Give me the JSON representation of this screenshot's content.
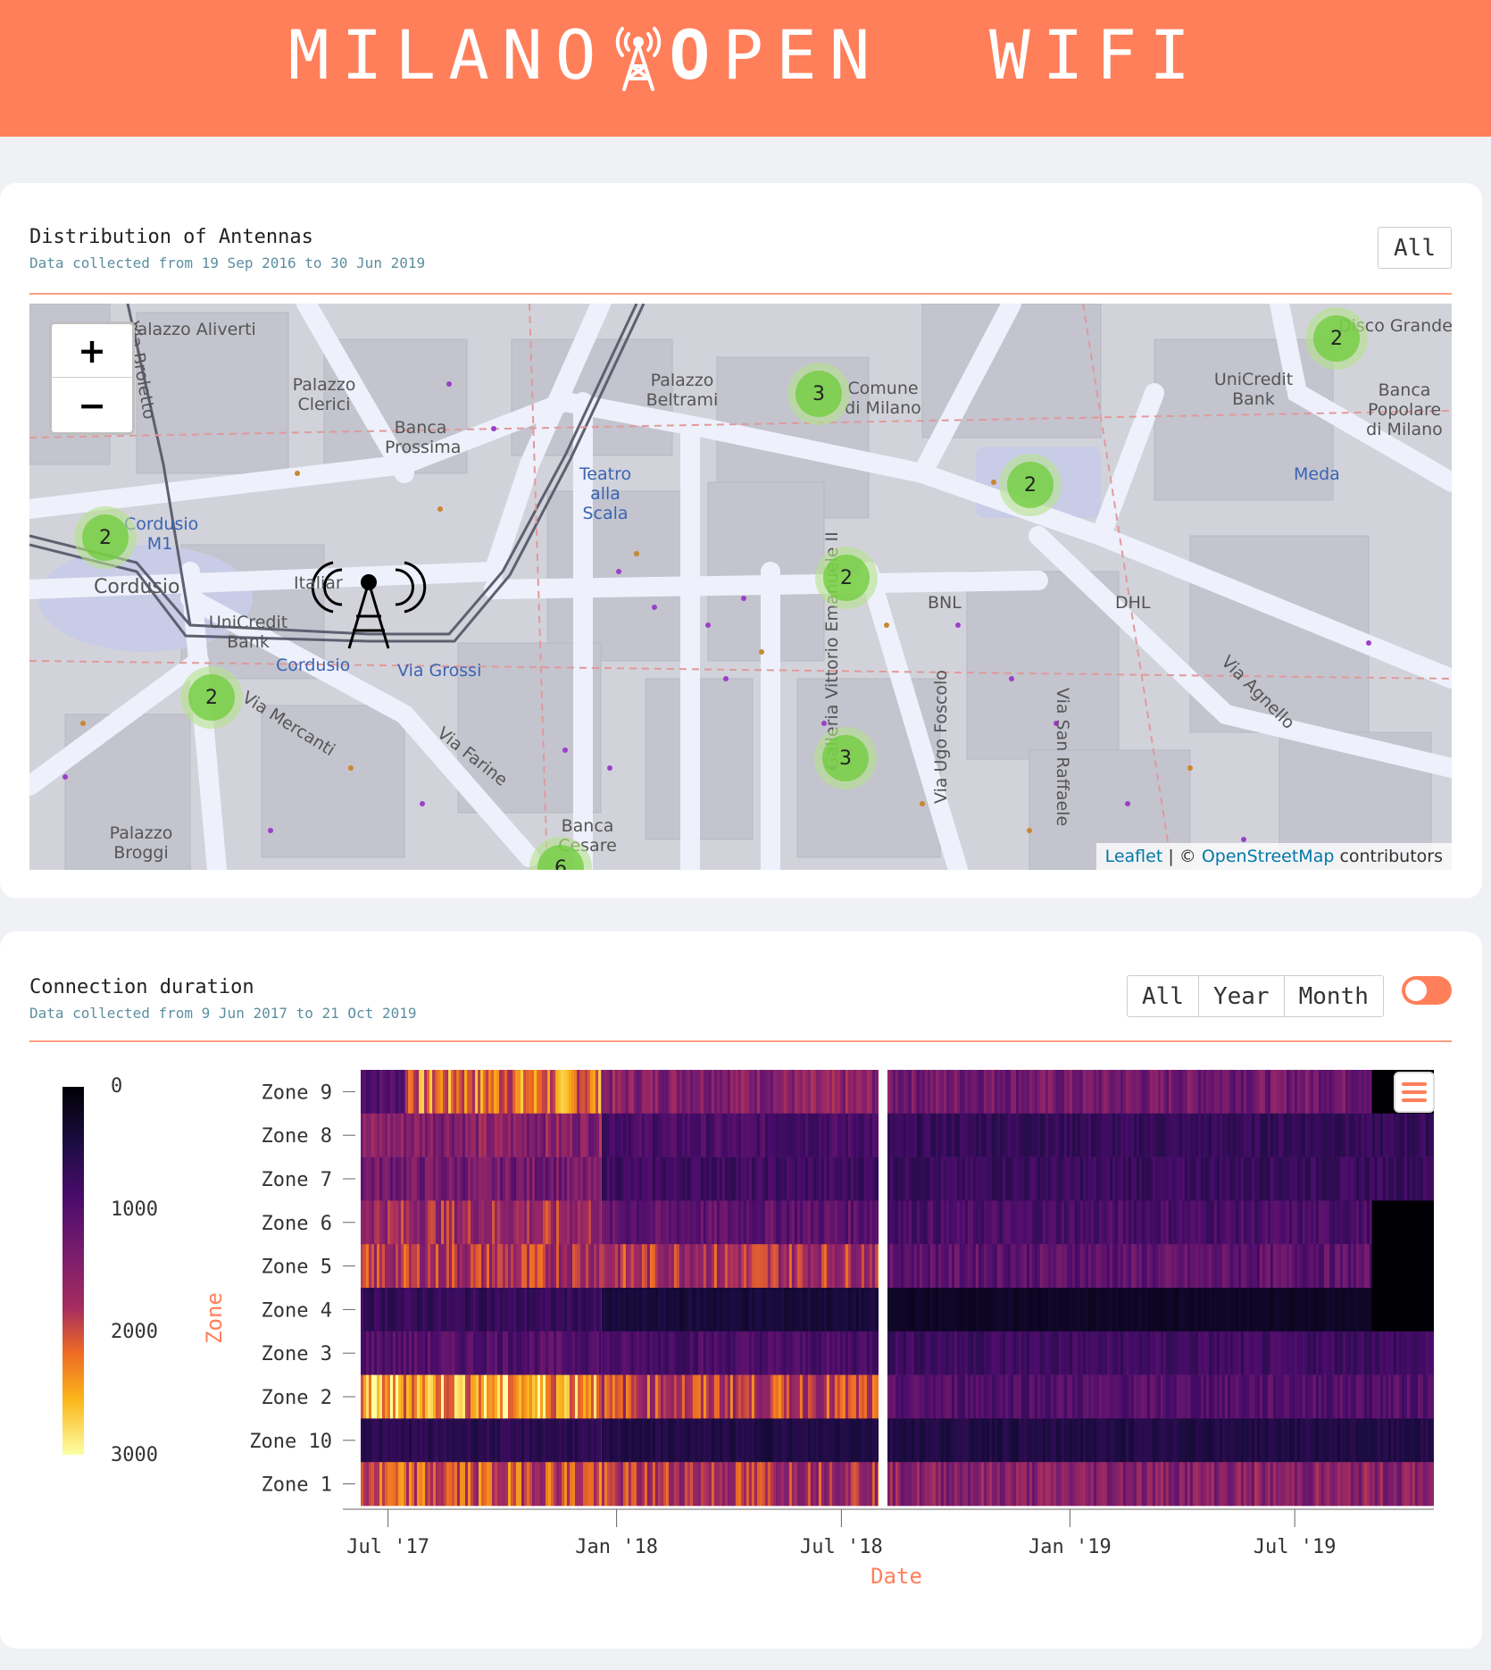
{
  "header": {
    "logo_part1": "MILANO",
    "logo_part2_bold": "O",
    "logo_part2": "PEN",
    "logo_part3": "WIFI",
    "tower_icon": "antenna-tower-icon",
    "bg_color": "#ff7f5a"
  },
  "map_card": {
    "title": "Distribution of Antennas",
    "subtitle": "Data collected from 19 Sep 2016 to 30 Jun 2019",
    "all_button": "All",
    "zoom_in": "+",
    "zoom_out": "−",
    "attribution_leaflet": "Leaflet",
    "attribution_sep": " | © ",
    "attribution_osm": "OpenStreetMap",
    "attribution_suffix": " contributors",
    "clusters": [
      "2",
      "3",
      "2",
      "2",
      "2",
      "2",
      "3",
      "6"
    ],
    "places": [
      "Palazzo Aliverti",
      "Palazzo Clerici",
      "Banca Prossima",
      "Palazzo Beltrami",
      "Comune di Milano",
      "UniCredit Bank",
      "Banca Popolare di Milano",
      "Meda",
      "Teatro alla Scala",
      "Cordusio M1",
      "Cordusio",
      "Italiar",
      "UniCredit Bank",
      "Cordusio",
      "Via Grossi",
      "Via Mercanti",
      "Via Farine",
      "Palazzo Broggi",
      "Banca Cesare",
      "BNL",
      "DHL",
      "Via Agnello",
      "Galleria Vittorio Emanuele II",
      "Via Ugo Foscolo",
      "Via San Raffaele",
      "Via Broletto",
      "Disco Grande"
    ]
  },
  "duration_card": {
    "title": "Connection duration",
    "subtitle": "Data collected from 9 Jun 2017 to 21 Oct 2019",
    "range_buttons": [
      "All",
      "Year",
      "Month"
    ],
    "toggle_on": true,
    "menu_icon": "hamburger-menu-icon"
  },
  "chart_data": {
    "type": "heatmap",
    "title": "",
    "xlabel": "Date",
    "ylabel": "Zone",
    "x_ticks": [
      "Jul '17",
      "Jan '18",
      "Jul '18",
      "Jan '19",
      "Jul '19"
    ],
    "x_range": [
      "2017-06-09",
      "2019-10-21"
    ],
    "rows": [
      "Zone 9",
      "Zone 8",
      "Zone 7",
      "Zone 6",
      "Zone 5",
      "Zone 4",
      "Zone 3",
      "Zone 2",
      "Zone 10",
      "Zone 1"
    ],
    "colorbar": {
      "ticks": [
        "0",
        "1000",
        "2000",
        "3000"
      ],
      "range": [
        0,
        3000
      ],
      "colorscale": "inferno-reversed"
    },
    "zone_levels": [
      {
        "zone": "Zone 9",
        "periods": [
          {
            "from": "2017-06-09",
            "to": "2017-07-15",
            "value": 1000
          },
          {
            "from": "2017-07-15",
            "to": "2017-12-20",
            "value": 2200
          },
          {
            "from": "2017-12-20",
            "to": "2018-07-31",
            "value": 1500
          },
          {
            "from": "2018-08-07",
            "to": "2019-09-01",
            "value": 1300
          },
          {
            "from": "2019-09-01",
            "to": "2019-10-21",
            "value": 0
          }
        ]
      },
      {
        "zone": "Zone 8",
        "periods": [
          {
            "from": "2017-06-09",
            "to": "2017-12-20",
            "value": 1500
          },
          {
            "from": "2017-12-20",
            "to": "2018-07-31",
            "value": 900
          },
          {
            "from": "2018-08-07",
            "to": "2019-10-21",
            "value": 700
          }
        ]
      },
      {
        "zone": "Zone 7",
        "periods": [
          {
            "from": "2017-06-09",
            "to": "2017-12-20",
            "value": 1300
          },
          {
            "from": "2017-12-20",
            "to": "2018-07-31",
            "value": 800
          },
          {
            "from": "2018-08-07",
            "to": "2019-10-21",
            "value": 750
          }
        ]
      },
      {
        "zone": "Zone 6",
        "periods": [
          {
            "from": "2017-06-09",
            "to": "2017-12-20",
            "value": 1700
          },
          {
            "from": "2017-12-20",
            "to": "2018-07-31",
            "value": 1100
          },
          {
            "from": "2018-08-07",
            "to": "2019-09-01",
            "value": 900
          },
          {
            "from": "2019-09-01",
            "to": "2019-10-21",
            "value": 0
          }
        ]
      },
      {
        "zone": "Zone 5",
        "periods": [
          {
            "from": "2017-06-09",
            "to": "2017-12-20",
            "value": 1800
          },
          {
            "from": "2017-12-20",
            "to": "2018-07-31",
            "value": 1800
          },
          {
            "from": "2018-08-07",
            "to": "2019-09-01",
            "value": 1100
          },
          {
            "from": "2019-09-01",
            "to": "2019-10-21",
            "value": 0
          }
        ]
      },
      {
        "zone": "Zone 4",
        "periods": [
          {
            "from": "2017-06-09",
            "to": "2017-12-20",
            "value": 700
          },
          {
            "from": "2017-12-20",
            "to": "2018-07-31",
            "value": 400
          },
          {
            "from": "2018-08-07",
            "to": "2019-09-01",
            "value": 250
          },
          {
            "from": "2019-09-01",
            "to": "2019-10-21",
            "value": 0
          }
        ]
      },
      {
        "zone": "Zone 3",
        "periods": [
          {
            "from": "2017-06-09",
            "to": "2017-12-20",
            "value": 1000
          },
          {
            "from": "2017-12-20",
            "to": "2018-07-31",
            "value": 900
          },
          {
            "from": "2018-08-07",
            "to": "2019-10-21",
            "value": 800
          }
        ]
      },
      {
        "zone": "Zone 2",
        "periods": [
          {
            "from": "2017-06-09",
            "to": "2017-12-20",
            "value": 2500
          },
          {
            "from": "2017-12-20",
            "to": "2018-07-31",
            "value": 1900
          },
          {
            "from": "2018-08-07",
            "to": "2019-10-21",
            "value": 1000
          }
        ]
      },
      {
        "zone": "Zone 10",
        "periods": [
          {
            "from": "2017-06-09",
            "to": "2017-12-20",
            "value": 600
          },
          {
            "from": "2017-12-20",
            "to": "2018-07-31",
            "value": 500
          },
          {
            "from": "2018-08-07",
            "to": "2019-10-21",
            "value": 500
          }
        ]
      },
      {
        "zone": "Zone 1",
        "periods": [
          {
            "from": "2017-06-09",
            "to": "2017-12-20",
            "value": 2000
          },
          {
            "from": "2017-12-20",
            "to": "2018-07-31",
            "value": 1800
          },
          {
            "from": "2018-08-07",
            "to": "2019-10-21",
            "value": 1500
          }
        ]
      }
    ],
    "gap": {
      "from": "2018-07-31",
      "to": "2018-08-07"
    }
  }
}
